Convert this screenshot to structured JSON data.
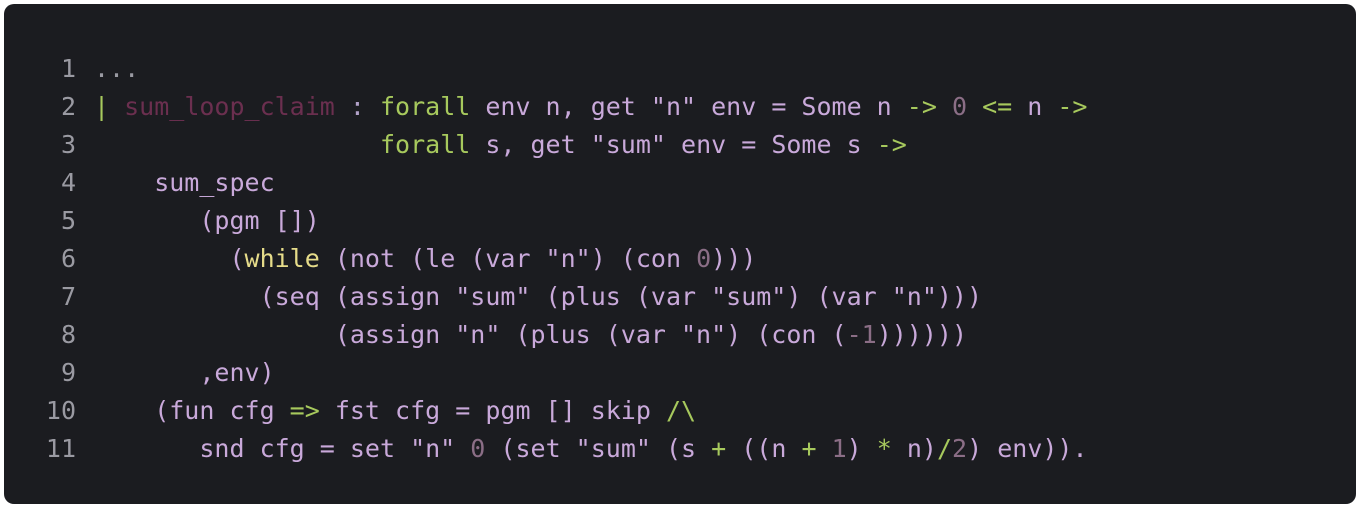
{
  "colors": {
    "background": "#1b1c20",
    "line_number": "#9a9aa2",
    "identifier": "#c9a9da",
    "keyword": "#a7c95d",
    "definition": "#6b2f4f",
    "number": "#8b6e86",
    "while_keyword": "#e6dc8a"
  },
  "lines": [
    {
      "n": "1",
      "tokens": [
        {
          "t": "...",
          "c": "t-dim"
        }
      ]
    },
    {
      "n": "2",
      "tokens": [
        {
          "t": "| ",
          "c": "t-kw"
        },
        {
          "t": "sum_loop_claim",
          "c": "t-def"
        },
        {
          "t": " : ",
          "c": "t-punc"
        },
        {
          "t": "forall",
          "c": "t-kw"
        },
        {
          "t": " env n, get \"n\" env = Some n ",
          "c": "t-id"
        },
        {
          "t": "->",
          "c": "t-kw"
        },
        {
          "t": " ",
          "c": "t-id"
        },
        {
          "t": "0",
          "c": "t-num"
        },
        {
          "t": " ",
          "c": "t-id"
        },
        {
          "t": "<=",
          "c": "t-kw"
        },
        {
          "t": " n ",
          "c": "t-id"
        },
        {
          "t": "->",
          "c": "t-kw"
        }
      ]
    },
    {
      "n": "3",
      "tokens": [
        {
          "t": "                   ",
          "c": "t-id"
        },
        {
          "t": "forall",
          "c": "t-kw"
        },
        {
          "t": " s, get \"sum\" env = Some s ",
          "c": "t-id"
        },
        {
          "t": "->",
          "c": "t-kw"
        }
      ]
    },
    {
      "n": "4",
      "tokens": [
        {
          "t": "    sum_spec",
          "c": "t-id"
        }
      ]
    },
    {
      "n": "5",
      "tokens": [
        {
          "t": "       (pgm [])",
          "c": "t-id"
        }
      ]
    },
    {
      "n": "6",
      "tokens": [
        {
          "t": "         (",
          "c": "t-id"
        },
        {
          "t": "while",
          "c": "t-while"
        },
        {
          "t": " (not (le (var \"n\") (con ",
          "c": "t-id"
        },
        {
          "t": "0",
          "c": "t-num"
        },
        {
          "t": ")))",
          "c": "t-id"
        }
      ]
    },
    {
      "n": "7",
      "tokens": [
        {
          "t": "           (seq (assign \"sum\" (plus (var \"sum\") (var \"n\")))",
          "c": "t-id"
        }
      ]
    },
    {
      "n": "8",
      "tokens": [
        {
          "t": "                (assign \"n\" (plus (var \"n\") (con (",
          "c": "t-id"
        },
        {
          "t": "-1",
          "c": "t-num"
        },
        {
          "t": "))))))",
          "c": "t-id"
        }
      ]
    },
    {
      "n": "9",
      "tokens": [
        {
          "t": "       ,env)",
          "c": "t-id"
        }
      ]
    },
    {
      "n": "10",
      "tokens": [
        {
          "t": "    (fun cfg ",
          "c": "t-id"
        },
        {
          "t": "=>",
          "c": "t-kw"
        },
        {
          "t": " fst cfg = pgm [] skip ",
          "c": "t-id"
        },
        {
          "t": "/\\",
          "c": "t-kw"
        }
      ]
    },
    {
      "n": "11",
      "tokens": [
        {
          "t": "       snd cfg = set \"n\" ",
          "c": "t-id"
        },
        {
          "t": "0",
          "c": "t-num"
        },
        {
          "t": " (set \"sum\" (s ",
          "c": "t-id"
        },
        {
          "t": "+",
          "c": "t-kw"
        },
        {
          "t": " ((n ",
          "c": "t-id"
        },
        {
          "t": "+",
          "c": "t-kw"
        },
        {
          "t": " ",
          "c": "t-id"
        },
        {
          "t": "1",
          "c": "t-num"
        },
        {
          "t": ") ",
          "c": "t-id"
        },
        {
          "t": "*",
          "c": "t-kw"
        },
        {
          "t": " n)",
          "c": "t-id"
        },
        {
          "t": "/",
          "c": "t-kw"
        },
        {
          "t": "2",
          "c": "t-num"
        },
        {
          "t": ") env)).",
          "c": "t-id"
        }
      ]
    }
  ]
}
